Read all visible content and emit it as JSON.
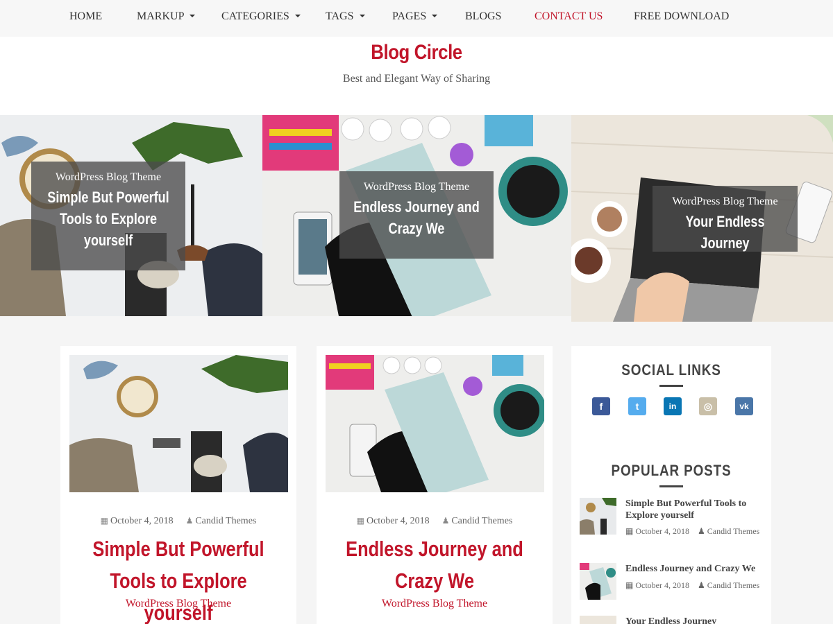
{
  "nav": {
    "items": [
      {
        "label": "HOME",
        "dropdown": false
      },
      {
        "label": "MARKUP",
        "dropdown": true
      },
      {
        "label": "CATEGORIES",
        "dropdown": true
      },
      {
        "label": "TAGS",
        "dropdown": true
      },
      {
        "label": "PAGES",
        "dropdown": true
      },
      {
        "label": "BLOGS",
        "dropdown": false
      },
      {
        "label": "CONTACT US",
        "dropdown": false,
        "active": true
      },
      {
        "label": "FREE DOWNLOAD",
        "dropdown": false
      }
    ]
  },
  "site": {
    "title": "Blog Circle",
    "tagline": "Best and Elegant Way of Sharing"
  },
  "slider": [
    {
      "category": "WordPress Blog Theme",
      "title": "Simple But Powerful Tools to Explore yourself"
    },
    {
      "category": "WordPress Blog Theme",
      "title": "Endless Journey and Crazy We"
    },
    {
      "category": "WordPress Blog Theme",
      "title": "Your Endless Journey"
    }
  ],
  "posts": [
    {
      "date": "October 4, 2018",
      "author": "Candid Themes",
      "title": "Simple But Powerful Tools to Explore yourself",
      "category": "WordPress Blog Theme"
    },
    {
      "date": "October 4, 2018",
      "author": "Candid Themes",
      "title": "Endless Journey and Crazy We",
      "category": "WordPress Blog Theme"
    }
  ],
  "sidebar": {
    "social_title": "SOCIAL LINKS",
    "social": [
      {
        "name": "facebook",
        "glyph": "f",
        "color": "#3b5998"
      },
      {
        "name": "twitter",
        "glyph": "t",
        "color": "#55acee"
      },
      {
        "name": "linkedin",
        "glyph": "in",
        "color": "#0976b4"
      },
      {
        "name": "instagram",
        "glyph": "◎",
        "color": "#c9bfa8"
      },
      {
        "name": "vk",
        "glyph": "vk",
        "color": "#4a76a8"
      }
    ],
    "popular_title": "POPULAR POSTS",
    "popular": [
      {
        "title": "Simple But Powerful Tools to Explore yourself",
        "date": "October 4, 2018",
        "author": "Candid Themes"
      },
      {
        "title": "Endless Journey and Crazy We",
        "date": "October 4, 2018",
        "author": "Candid Themes"
      },
      {
        "title": "Your Endless Journey"
      }
    ]
  },
  "colors": {
    "accent": "#c1152a",
    "text": "#444444",
    "background": "#f5f5f5"
  }
}
